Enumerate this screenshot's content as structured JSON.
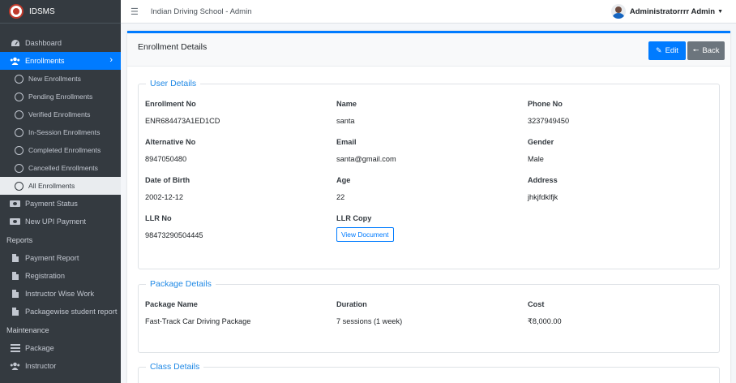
{
  "brand": {
    "name": "IDSMS",
    "logo_icon": "school-logo-icon"
  },
  "topbar": {
    "menu_icon": "hamburger-icon",
    "title": "Indian Driving School - Admin",
    "user_name": "Administratorrrr Admin"
  },
  "sidebar": {
    "items": [
      {
        "label": "Dashboard",
        "icon": "dashboard-icon"
      },
      {
        "label": "Enrollments",
        "icon": "users-icon",
        "active": true
      }
    ],
    "enrollment_sub": [
      {
        "label": "New Enrollments"
      },
      {
        "label": "Pending Enrollments"
      },
      {
        "label": "Verified Enrollments"
      },
      {
        "label": "In-Session Enrollments"
      },
      {
        "label": "Completed Enrollments"
      },
      {
        "label": "Cancelled Enrollments"
      },
      {
        "label": "All Enrollments",
        "current": true
      }
    ],
    "payment_items": [
      {
        "label": "Payment Status",
        "icon": "money-icon"
      },
      {
        "label": "New UPI Payment",
        "icon": "money-icon"
      }
    ],
    "reports_header": "Reports",
    "reports": [
      {
        "label": "Payment Report",
        "icon": "file-icon"
      },
      {
        "label": "Registration",
        "icon": "file-icon"
      },
      {
        "label": "Instructor Wise Work",
        "icon": "file-icon"
      },
      {
        "label": "Packagewise student report",
        "icon": "file-icon"
      }
    ],
    "maintenance_header": "Maintenance",
    "maintenance": [
      {
        "label": "Package",
        "icon": "table-icon"
      },
      {
        "label": "Instructor",
        "icon": "users-icon"
      }
    ]
  },
  "card": {
    "title": "Enrollment Details",
    "edit_label": "Edit",
    "back_label": "Back"
  },
  "user_details": {
    "legend": "User Details",
    "enrollment_no_label": "Enrollment No",
    "enrollment_no": "ENR684473A1ED1CD",
    "name_label": "Name",
    "name": "santa",
    "phone_label": "Phone No",
    "phone": "3237949450",
    "alt_no_label": "Alternative No",
    "alt_no": "8947050480",
    "email_label": "Email",
    "email": "santa@gmail.com",
    "gender_label": "Gender",
    "gender": "Male",
    "dob_label": "Date of Birth",
    "dob": "2002-12-12",
    "age_label": "Age",
    "age": "22",
    "address_label": "Address",
    "address": "jhkjfdklfjk",
    "llr_no_label": "LLR No",
    "llr_no": "98473290504445",
    "llr_copy_label": "LLR Copy",
    "view_doc_label": "View Document"
  },
  "package_details": {
    "legend": "Package Details",
    "package_name_label": "Package Name",
    "package_name": "Fast-Track Car Driving Package",
    "duration_label": "Duration",
    "duration": "7 sessions (1 week)",
    "cost_label": "Cost",
    "cost": "₹8,000.00"
  },
  "class_details": {
    "legend": "Class Details"
  }
}
